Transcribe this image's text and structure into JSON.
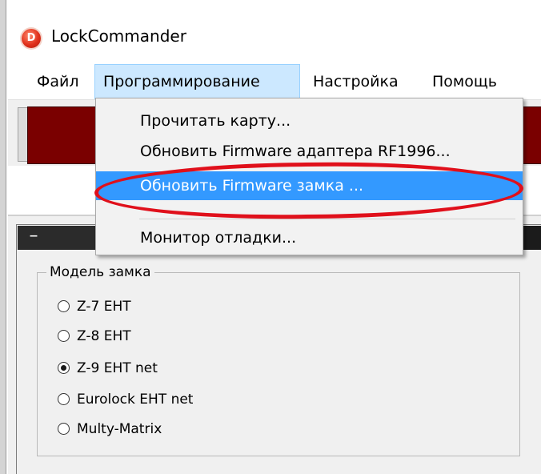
{
  "window": {
    "title": "LockCommander",
    "icon_letter": "D",
    "icon": "app-logo-icon"
  },
  "menubar": {
    "items": [
      {
        "label": "Файл"
      },
      {
        "label": "Программирование",
        "active": true
      },
      {
        "label": "Настройка"
      },
      {
        "label": "Помощь"
      }
    ]
  },
  "dropdown": {
    "items": [
      {
        "label": "Прочитать карту..."
      },
      {
        "label": "Обновить Firmware адаптера RF1996..."
      },
      {
        "label": "Обновить Firmware замка ...",
        "highlighted": true
      },
      {
        "label": "Монитор отладки..."
      }
    ]
  },
  "panel": {
    "collapse_symbol": "–"
  },
  "lock_model": {
    "title": "Модель замка",
    "options": [
      {
        "label": "Z-7 EHT",
        "checked": false
      },
      {
        "label": "Z-8 EHT",
        "checked": false
      },
      {
        "label": "Z-9 EHT net",
        "checked": true
      },
      {
        "label": "Eurolock EHT net",
        "checked": false
      },
      {
        "label": "Multy-Matrix",
        "checked": false
      }
    ]
  },
  "colors": {
    "highlight": "#3399ff",
    "menu_active": "#cce8ff",
    "annotation": "#e0101b",
    "status_panel": "#7a0000"
  }
}
